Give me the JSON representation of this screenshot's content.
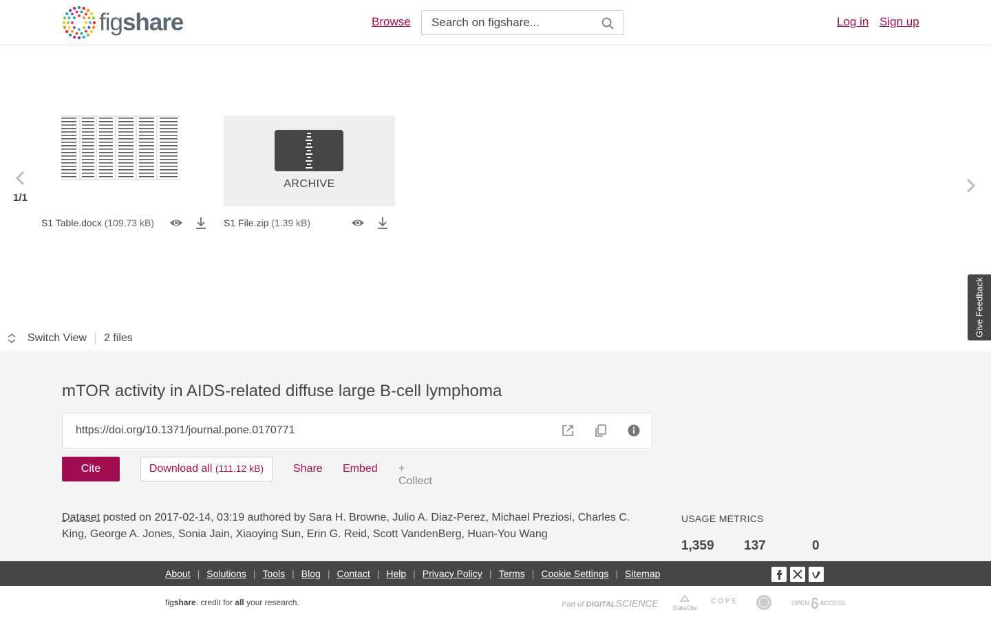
{
  "header": {
    "logo_word_light": "fig",
    "logo_word_bold": "share",
    "browse": "Browse",
    "search_placeholder": "Search on figshare...",
    "login": "Log in",
    "signup": "Sign up"
  },
  "preview": {
    "page_indicator": "1/1",
    "files": [
      {
        "name": "S1 Table.docx",
        "size": "(109.73 kB)"
      },
      {
        "name": "S1 File.zip",
        "size": "(1.39 kB)",
        "thumb_label": "ARCHIVE"
      }
    ],
    "switch_view": "Switch View",
    "file_count": "2 files",
    "feedback": "Give Feedback"
  },
  "item": {
    "title": "mTOR activity in AIDS-related diffuse large B-cell lymphoma",
    "doi": "https://doi.org/10.1371/journal.pone.0170771",
    "cite": "Cite",
    "download_all": "Download all",
    "download_size": "(111.12 kB)",
    "share": "Share",
    "embed": "Embed",
    "collect": "+ Collect",
    "type": "Dataset",
    "posted_text": " posted on 2017-02-14, 03:19 authored by Sara H. Browne, Julio A. Diaz-Perez, Michael Preziosi, Charles C. King, George A. Jones, Sonia Jain, Xiaoying Sun, Erin G. Reid, Scott VandenBerg, Huan-You Wang"
  },
  "usage": {
    "title": "USAGE METRICS",
    "values": [
      "1,359",
      "137",
      "0"
    ]
  },
  "footer": {
    "links": [
      "About",
      "Solutions",
      "Tools",
      "Blog",
      "Contact",
      "Help",
      "Privacy Policy",
      "Terms",
      "Cookie Settings",
      "Sitemap"
    ],
    "social": [
      "facebook-icon",
      "x-icon",
      "vimeo-icon"
    ],
    "tagline_fig": "fig",
    "tagline_share": "share",
    "tagline_mid": ". credit for ",
    "tagline_all": "all",
    "tagline_end": " your research.",
    "partners": [
      "Part of",
      "DIGITAL",
      "SCIENCE",
      "DataCite",
      "COPE",
      "OPEN",
      "ACCESS"
    ]
  },
  "colors": {
    "brand": "#a00e51",
    "dark": "#464646"
  }
}
